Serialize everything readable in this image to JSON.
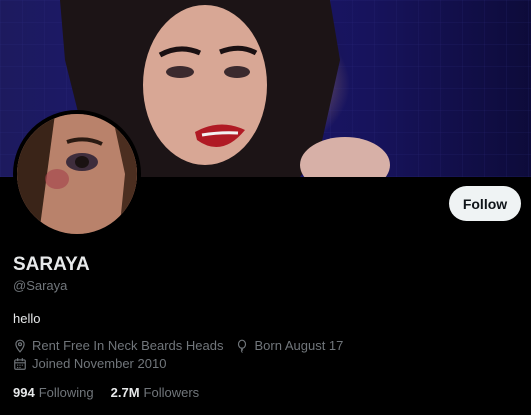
{
  "profile": {
    "display_name": "SARAYA",
    "handle": "@Saraya",
    "bio": "hello",
    "location": "Rent Free In Neck Beards Heads",
    "birthday": "Born August 17",
    "joined": "Joined November 2010",
    "follow_label": "Follow"
  },
  "stats": {
    "following_count": "994",
    "following_label": "Following",
    "followers_count": "2.7M",
    "followers_label": "Followers"
  },
  "icons": {
    "location": "location-pin-icon",
    "birthday": "balloon-icon",
    "joined": "calendar-icon"
  },
  "colors": {
    "background": "#000000",
    "text_primary": "#e7e9ea",
    "text_secondary": "#71767b",
    "follow_button_bg": "#eff3f4",
    "follow_button_text": "#0f1419"
  }
}
